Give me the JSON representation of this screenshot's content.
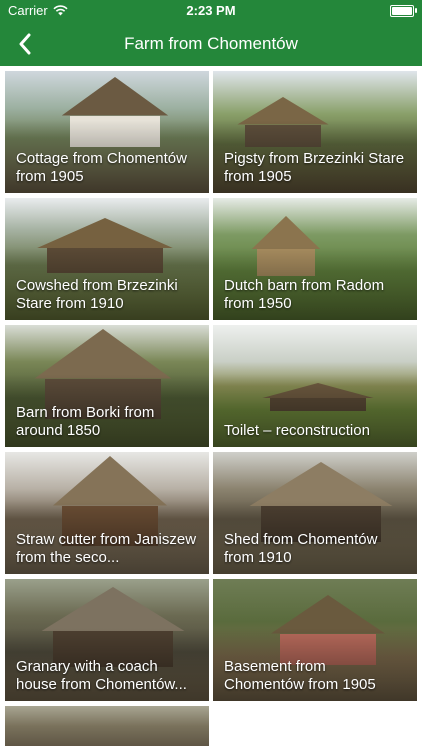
{
  "status": {
    "carrier": "Carrier",
    "time": "2:23 PM"
  },
  "nav": {
    "title": "Farm from Chomentów",
    "back_icon": "chevron-left-icon"
  },
  "colors": {
    "accent": "#24873a"
  },
  "tiles": [
    {
      "label": "Cottage from Chomentów from 1905"
    },
    {
      "label": "Pigsty from Brzezinki Stare from 1905"
    },
    {
      "label": "Cowshed from Brzezinki Stare from 1910"
    },
    {
      "label": "Dutch barn from Radom from 1950"
    },
    {
      "label": "Barn from Borki from around 1850"
    },
    {
      "label": "Toilet – reconstruction"
    },
    {
      "label": "Straw cutter from Janiszew from the seco..."
    },
    {
      "label": "Shed from Chomentów from 1910"
    },
    {
      "label": "Granary with a coach house from Chomentów..."
    },
    {
      "label": "Basement from Chomentów from 1905"
    },
    {
      "label": ""
    }
  ]
}
